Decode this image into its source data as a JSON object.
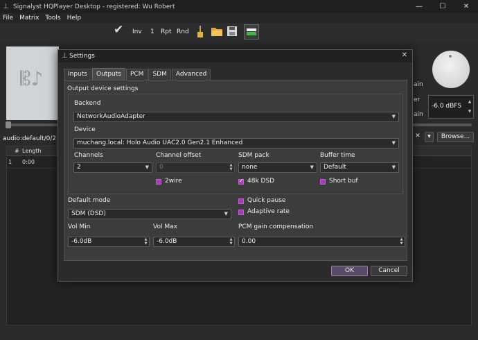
{
  "app": {
    "title": "Signalyst HQPlayer Desktop - registered: Wu Robert"
  },
  "menu": [
    "File",
    "Matrix",
    "Tools",
    "Help"
  ],
  "toolbar": {
    "inv": "Inv",
    "one": "1",
    "rpt": "Rpt",
    "rnd": "Rnd"
  },
  "background": {
    "gain_side_labels": [
      "ain",
      "er",
      "ain"
    ],
    "gain_value": "-6.0 dBFS",
    "path": "audio:default/0/2",
    "browse_label": "Browse...",
    "close_glyph": "✕",
    "dropdown_glyph": "▾",
    "playlist": {
      "headers": [
        "#",
        "Length"
      ],
      "rows": [
        {
          "index": "1",
          "length": "0:00"
        }
      ]
    }
  },
  "dialog": {
    "title": "Settings",
    "close": "✕",
    "tabs": [
      "Inputs",
      "Outputs",
      "PCM",
      "SDM",
      "Advanced"
    ],
    "active_tab": "Outputs",
    "section_title": "Output device settings",
    "backend": {
      "label": "Backend",
      "value": "NetworkAudioAdapter"
    },
    "device": {
      "label": "Device",
      "value": "muchang.local: Holo Audio UAC2.0 Gen2.1 Enhanced"
    },
    "channels": {
      "label": "Channels",
      "value": "2"
    },
    "channel_offset": {
      "label": "Channel offset",
      "value": "0"
    },
    "sdm_pack": {
      "label": "SDM pack",
      "value": "none"
    },
    "buffer_time": {
      "label": "Buffer time",
      "value": "Default"
    },
    "checkbox_2wire": {
      "label": "2wire",
      "checked": false
    },
    "checkbox_48k": {
      "label": "48k DSD",
      "checked": true
    },
    "checkbox_shortbuf": {
      "label": "Short buf",
      "checked": false
    },
    "default_mode": {
      "label": "Default mode",
      "value": "SDM (DSD)"
    },
    "quick_pause": {
      "label": "Quick pause",
      "checked": false
    },
    "adaptive_rate": {
      "label": "Adaptive rate",
      "checked": false
    },
    "vol_min": {
      "label": "Vol Min",
      "value": "-6.0dB"
    },
    "vol_max": {
      "label": "Vol Max",
      "value": "-6.0dB"
    },
    "pcm_gain": {
      "label": "PCM gain compensation",
      "value": "0.00"
    },
    "ok": "OK",
    "cancel": "Cancel"
  },
  "colors": {
    "checkbox_accent": "#a040b0",
    "ok_border": "#9b7fb0"
  }
}
